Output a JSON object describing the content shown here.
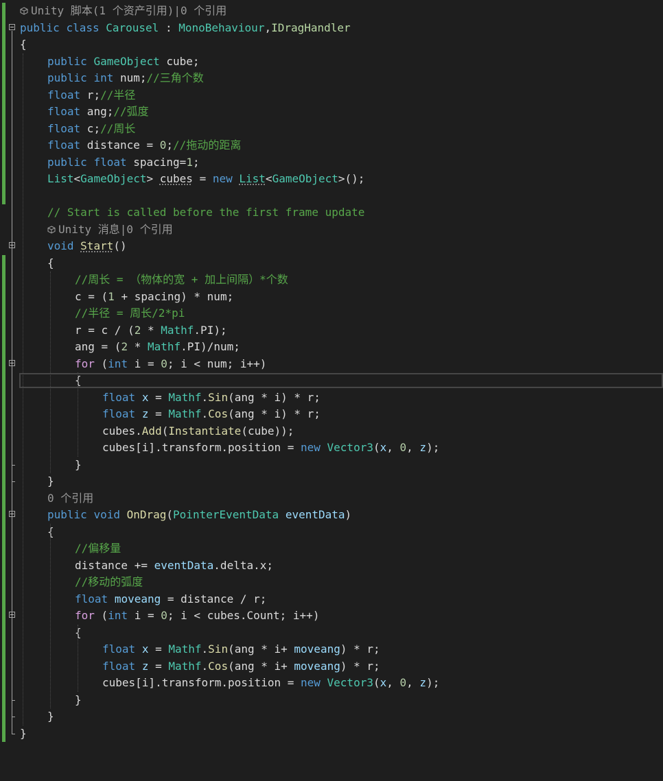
{
  "editor": {
    "lines": [
      {
        "kind": "lens",
        "icon": "unity-cube-icon",
        "text": "Unity 脚本(1 个资产引用)|0 个引用",
        "indent": 0
      },
      {
        "kind": "code",
        "fold": true,
        "indent": 0,
        "tokens": [
          {
            "t": "public",
            "c": "#569cd6"
          },
          {
            "t": " "
          },
          {
            "t": "class",
            "c": "#569cd6"
          },
          {
            "t": " "
          },
          {
            "t": "Carousel",
            "c": "#4ec9b0"
          },
          {
            "t": " : "
          },
          {
            "t": "MonoBehaviour",
            "c": "#4ec9b0"
          },
          {
            "t": ","
          },
          {
            "t": "IDragHandler",
            "c": "#b8d7a3"
          }
        ]
      },
      {
        "kind": "code",
        "indent": 0,
        "tokens": [
          {
            "t": "{"
          }
        ]
      },
      {
        "kind": "code",
        "indent": 2,
        "tokens": [
          {
            "t": "public",
            "c": "#569cd6"
          },
          {
            "t": " "
          },
          {
            "t": "GameObject",
            "c": "#4ec9b0"
          },
          {
            "t": " cube;"
          }
        ]
      },
      {
        "kind": "code",
        "indent": 2,
        "tokens": [
          {
            "t": "public",
            "c": "#569cd6"
          },
          {
            "t": " "
          },
          {
            "t": "int",
            "c": "#569cd6"
          },
          {
            "t": " num;"
          },
          {
            "t": "//三角个数",
            "c": "#57a64a"
          }
        ]
      },
      {
        "kind": "code",
        "indent": 2,
        "tokens": [
          {
            "t": "float",
            "c": "#569cd6"
          },
          {
            "t": " r;"
          },
          {
            "t": "//半径",
            "c": "#57a64a"
          }
        ]
      },
      {
        "kind": "code",
        "indent": 2,
        "tokens": [
          {
            "t": "float",
            "c": "#569cd6"
          },
          {
            "t": " ang;"
          },
          {
            "t": "//弧度",
            "c": "#57a64a"
          }
        ]
      },
      {
        "kind": "code",
        "indent": 2,
        "tokens": [
          {
            "t": "float",
            "c": "#569cd6"
          },
          {
            "t": " c;"
          },
          {
            "t": "//周长",
            "c": "#57a64a"
          }
        ]
      },
      {
        "kind": "code",
        "indent": 2,
        "tokens": [
          {
            "t": "float",
            "c": "#569cd6"
          },
          {
            "t": " distance = "
          },
          {
            "t": "0",
            "c": "#b5cea8"
          },
          {
            "t": ";"
          },
          {
            "t": "//拖动的距离",
            "c": "#57a64a"
          }
        ]
      },
      {
        "kind": "code",
        "indent": 2,
        "tokens": [
          {
            "t": "public",
            "c": "#569cd6"
          },
          {
            "t": " "
          },
          {
            "t": "float",
            "c": "#569cd6"
          },
          {
            "t": " spacing="
          },
          {
            "t": "1",
            "c": "#b5cea8"
          },
          {
            "t": ";"
          }
        ]
      },
      {
        "kind": "code",
        "indent": 2,
        "tokens": [
          {
            "t": "List",
            "c": "#4ec9b0"
          },
          {
            "t": "<"
          },
          {
            "t": "GameObject",
            "c": "#4ec9b0"
          },
          {
            "t": "> "
          },
          {
            "t": "cubes",
            "s": true
          },
          {
            "t": " = "
          },
          {
            "t": "new",
            "c": "#569cd6"
          },
          {
            "t": " "
          },
          {
            "t": "List",
            "c": "#4ec9b0",
            "s": true
          },
          {
            "t": "<"
          },
          {
            "t": "GameObject",
            "c": "#4ec9b0"
          },
          {
            "t": ">();"
          }
        ]
      },
      {
        "kind": "code",
        "indent": 0,
        "tokens": [
          {
            "t": ""
          }
        ]
      },
      {
        "kind": "code",
        "indent": 2,
        "tokens": [
          {
            "t": "// Start is called before the first frame update",
            "c": "#57a64a"
          }
        ]
      },
      {
        "kind": "lens",
        "icon": "unity-cube-icon",
        "text": "Unity 消息|0 个引用",
        "indent": 2
      },
      {
        "kind": "code",
        "fold": true,
        "indent": 2,
        "tokens": [
          {
            "t": "void",
            "c": "#569cd6"
          },
          {
            "t": " "
          },
          {
            "t": "Start",
            "c": "#dcdcaa",
            "s": true
          },
          {
            "t": "()"
          }
        ]
      },
      {
        "kind": "code",
        "indent": 2,
        "tokens": [
          {
            "t": "{"
          }
        ]
      },
      {
        "kind": "code",
        "indent": 4,
        "tokens": [
          {
            "t": "//周长 = （物体的宽 + 加上间隔）*个数",
            "c": "#57a64a"
          }
        ]
      },
      {
        "kind": "code",
        "indent": 4,
        "tokens": [
          {
            "t": "c = ("
          },
          {
            "t": "1",
            "c": "#b5cea8"
          },
          {
            "t": " + spacing) * num;"
          }
        ]
      },
      {
        "kind": "code",
        "indent": 4,
        "tokens": [
          {
            "t": "//半径 = 周长/2*pi",
            "c": "#57a64a"
          }
        ]
      },
      {
        "kind": "code",
        "indent": 4,
        "tokens": [
          {
            "t": "r = c / ("
          },
          {
            "t": "2",
            "c": "#b5cea8"
          },
          {
            "t": " * "
          },
          {
            "t": "Mathf",
            "c": "#4ec9b0"
          },
          {
            "t": ".PI);"
          }
        ]
      },
      {
        "kind": "code",
        "indent": 4,
        "tokens": [
          {
            "t": "ang = ("
          },
          {
            "t": "2",
            "c": "#b5cea8"
          },
          {
            "t": " * "
          },
          {
            "t": "Mathf",
            "c": "#4ec9b0"
          },
          {
            "t": ".PI)/num;"
          }
        ]
      },
      {
        "kind": "code",
        "fold": true,
        "indent": 4,
        "tokens": [
          {
            "t": "for",
            "c": "#d8a0df"
          },
          {
            "t": " ("
          },
          {
            "t": "int",
            "c": "#569cd6"
          },
          {
            "t": " i = "
          },
          {
            "t": "0",
            "c": "#b5cea8"
          },
          {
            "t": "; i < num; i++)"
          }
        ]
      },
      {
        "kind": "code",
        "indent": 4,
        "current": true,
        "tokens": [
          {
            "t": "{"
          }
        ]
      },
      {
        "kind": "code",
        "indent": 6,
        "tokens": [
          {
            "t": "float",
            "c": "#569cd6"
          },
          {
            "t": " "
          },
          {
            "t": "x",
            "c": "#9cdcfe"
          },
          {
            "t": " = "
          },
          {
            "t": "Mathf",
            "c": "#4ec9b0"
          },
          {
            "t": "."
          },
          {
            "t": "Sin",
            "c": "#dcdcaa"
          },
          {
            "t": "(ang * i) * r;"
          }
        ]
      },
      {
        "kind": "code",
        "indent": 6,
        "tokens": [
          {
            "t": "float",
            "c": "#569cd6"
          },
          {
            "t": " "
          },
          {
            "t": "z",
            "c": "#9cdcfe"
          },
          {
            "t": " = "
          },
          {
            "t": "Mathf",
            "c": "#4ec9b0"
          },
          {
            "t": "."
          },
          {
            "t": "Cos",
            "c": "#dcdcaa"
          },
          {
            "t": "(ang * i) * r;"
          }
        ]
      },
      {
        "kind": "code",
        "indent": 6,
        "tokens": [
          {
            "t": "cubes."
          },
          {
            "t": "Add",
            "c": "#dcdcaa"
          },
          {
            "t": "("
          },
          {
            "t": "Instantiate",
            "c": "#dcdcaa"
          },
          {
            "t": "(cube));"
          }
        ]
      },
      {
        "kind": "code",
        "indent": 6,
        "tokens": [
          {
            "t": "cubes[i].transform.position = "
          },
          {
            "t": "new",
            "c": "#569cd6"
          },
          {
            "t": " "
          },
          {
            "t": "Vector3",
            "c": "#4ec9b0"
          },
          {
            "t": "("
          },
          {
            "t": "x",
            "c": "#9cdcfe"
          },
          {
            "t": ", "
          },
          {
            "t": "0",
            "c": "#b5cea8"
          },
          {
            "t": ", "
          },
          {
            "t": "z",
            "c": "#9cdcfe"
          },
          {
            "t": ");"
          }
        ]
      },
      {
        "kind": "code",
        "indent": 4,
        "tokens": [
          {
            "t": "}"
          }
        ]
      },
      {
        "kind": "code",
        "indent": 2,
        "tokens": [
          {
            "t": "}"
          }
        ]
      },
      {
        "kind": "lens",
        "text": "0 个引用",
        "indent": 2
      },
      {
        "kind": "code",
        "fold": true,
        "indent": 2,
        "tokens": [
          {
            "t": "public",
            "c": "#569cd6"
          },
          {
            "t": " "
          },
          {
            "t": "void",
            "c": "#569cd6"
          },
          {
            "t": " "
          },
          {
            "t": "OnDrag",
            "c": "#dcdcaa"
          },
          {
            "t": "("
          },
          {
            "t": "PointerEventData",
            "c": "#4ec9b0"
          },
          {
            "t": " "
          },
          {
            "t": "eventData",
            "c": "#9cdcfe"
          },
          {
            "t": ")"
          }
        ]
      },
      {
        "kind": "code",
        "indent": 2,
        "tokens": [
          {
            "t": "{"
          }
        ]
      },
      {
        "kind": "code",
        "indent": 4,
        "tokens": [
          {
            "t": "//偏移量",
            "c": "#57a64a"
          }
        ]
      },
      {
        "kind": "code",
        "indent": 4,
        "tokens": [
          {
            "t": "distance += "
          },
          {
            "t": "eventData",
            "c": "#9cdcfe"
          },
          {
            "t": ".delta.x;"
          }
        ]
      },
      {
        "kind": "code",
        "indent": 4,
        "tokens": [
          {
            "t": "//移动的弧度",
            "c": "#57a64a"
          }
        ]
      },
      {
        "kind": "code",
        "indent": 4,
        "tokens": [
          {
            "t": "float",
            "c": "#569cd6"
          },
          {
            "t": " "
          },
          {
            "t": "moveang",
            "c": "#9cdcfe"
          },
          {
            "t": " = distance / r;"
          }
        ]
      },
      {
        "kind": "code",
        "fold": true,
        "indent": 4,
        "tokens": [
          {
            "t": "for",
            "c": "#d8a0df"
          },
          {
            "t": " ("
          },
          {
            "t": "int",
            "c": "#569cd6"
          },
          {
            "t": " i = "
          },
          {
            "t": "0",
            "c": "#b5cea8"
          },
          {
            "t": "; i < cubes.Count; i++)"
          }
        ]
      },
      {
        "kind": "code",
        "indent": 4,
        "tokens": [
          {
            "t": "{"
          }
        ]
      },
      {
        "kind": "code",
        "indent": 6,
        "tokens": [
          {
            "t": "float",
            "c": "#569cd6"
          },
          {
            "t": " "
          },
          {
            "t": "x",
            "c": "#9cdcfe"
          },
          {
            "t": " = "
          },
          {
            "t": "Mathf",
            "c": "#4ec9b0"
          },
          {
            "t": "."
          },
          {
            "t": "Sin",
            "c": "#dcdcaa"
          },
          {
            "t": "(ang * i+ "
          },
          {
            "t": "moveang",
            "c": "#9cdcfe"
          },
          {
            "t": ") * r;"
          }
        ]
      },
      {
        "kind": "code",
        "indent": 6,
        "tokens": [
          {
            "t": "float",
            "c": "#569cd6"
          },
          {
            "t": " "
          },
          {
            "t": "z",
            "c": "#9cdcfe"
          },
          {
            "t": " = "
          },
          {
            "t": "Mathf",
            "c": "#4ec9b0"
          },
          {
            "t": "."
          },
          {
            "t": "Cos",
            "c": "#dcdcaa"
          },
          {
            "t": "(ang * i+ "
          },
          {
            "t": "moveang",
            "c": "#9cdcfe"
          },
          {
            "t": ") * r;"
          }
        ]
      },
      {
        "kind": "code",
        "indent": 6,
        "tokens": [
          {
            "t": "cubes[i].transform.position = "
          },
          {
            "t": "new",
            "c": "#569cd6"
          },
          {
            "t": " "
          },
          {
            "t": "Vector3",
            "c": "#4ec9b0"
          },
          {
            "t": "("
          },
          {
            "t": "x",
            "c": "#9cdcfe"
          },
          {
            "t": ", "
          },
          {
            "t": "0",
            "c": "#b5cea8"
          },
          {
            "t": ", "
          },
          {
            "t": "z",
            "c": "#9cdcfe"
          },
          {
            "t": ");"
          }
        ]
      },
      {
        "kind": "code",
        "indent": 4,
        "tokens": [
          {
            "t": "}"
          }
        ]
      },
      {
        "kind": "code",
        "indent": 2,
        "tokens": [
          {
            "t": "}"
          }
        ]
      },
      {
        "kind": "code",
        "indent": 0,
        "tokens": [
          {
            "t": "}"
          }
        ]
      }
    ]
  },
  "colors": {
    "background": "#1e1e1e",
    "text": "#dcdcdc",
    "keyword": "#569cd6",
    "type": "#4ec9b0",
    "comment": "#57a64a",
    "method": "#dcdcaa",
    "number": "#b5cea8",
    "control": "#d8a0df",
    "variable": "#9cdcfe",
    "change-bar": "#57a64a"
  }
}
